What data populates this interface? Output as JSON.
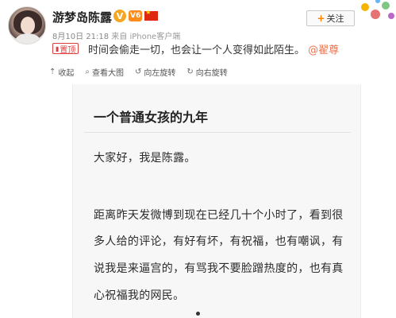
{
  "header": {
    "username": "游梦岛陈露",
    "badges": {
      "verified": "V",
      "vip": "V6"
    },
    "follow_label": "关注",
    "meta": {
      "date": "8月10日 21:18",
      "source": "来自 iPhone客户端"
    }
  },
  "post": {
    "pin_label": "置顶",
    "text": "时间会偷走一切，也会让一个人变得如此陌生。",
    "mention": "@翟尊"
  },
  "toolbar": {
    "items": [
      {
        "icon": "collapse-icon",
        "label": "收起"
      },
      {
        "icon": "zoom-icon",
        "label": "查看大图"
      },
      {
        "icon": "rotate-left-icon",
        "label": "向左旋转"
      },
      {
        "icon": "rotate-right-icon",
        "label": "向右旋转"
      }
    ]
  },
  "article": {
    "title": "一个普通女孩的九年",
    "lines": [
      "大家好，我是陈露。",
      "距离昨天发微博到现在已经几十个小时了，看到很",
      "多人给的评论，有好有坏，有祝福，也有嘲讽，有",
      "说我是来逼宫的，有骂我不要脸蹭热度的，也有真",
      "心祝福我的网民。"
    ]
  },
  "colors": {
    "mention": "#eb7350",
    "pin": "#e03c3c",
    "follow_plus": "#ff8200",
    "vip_badge": "#ff8c1a"
  }
}
